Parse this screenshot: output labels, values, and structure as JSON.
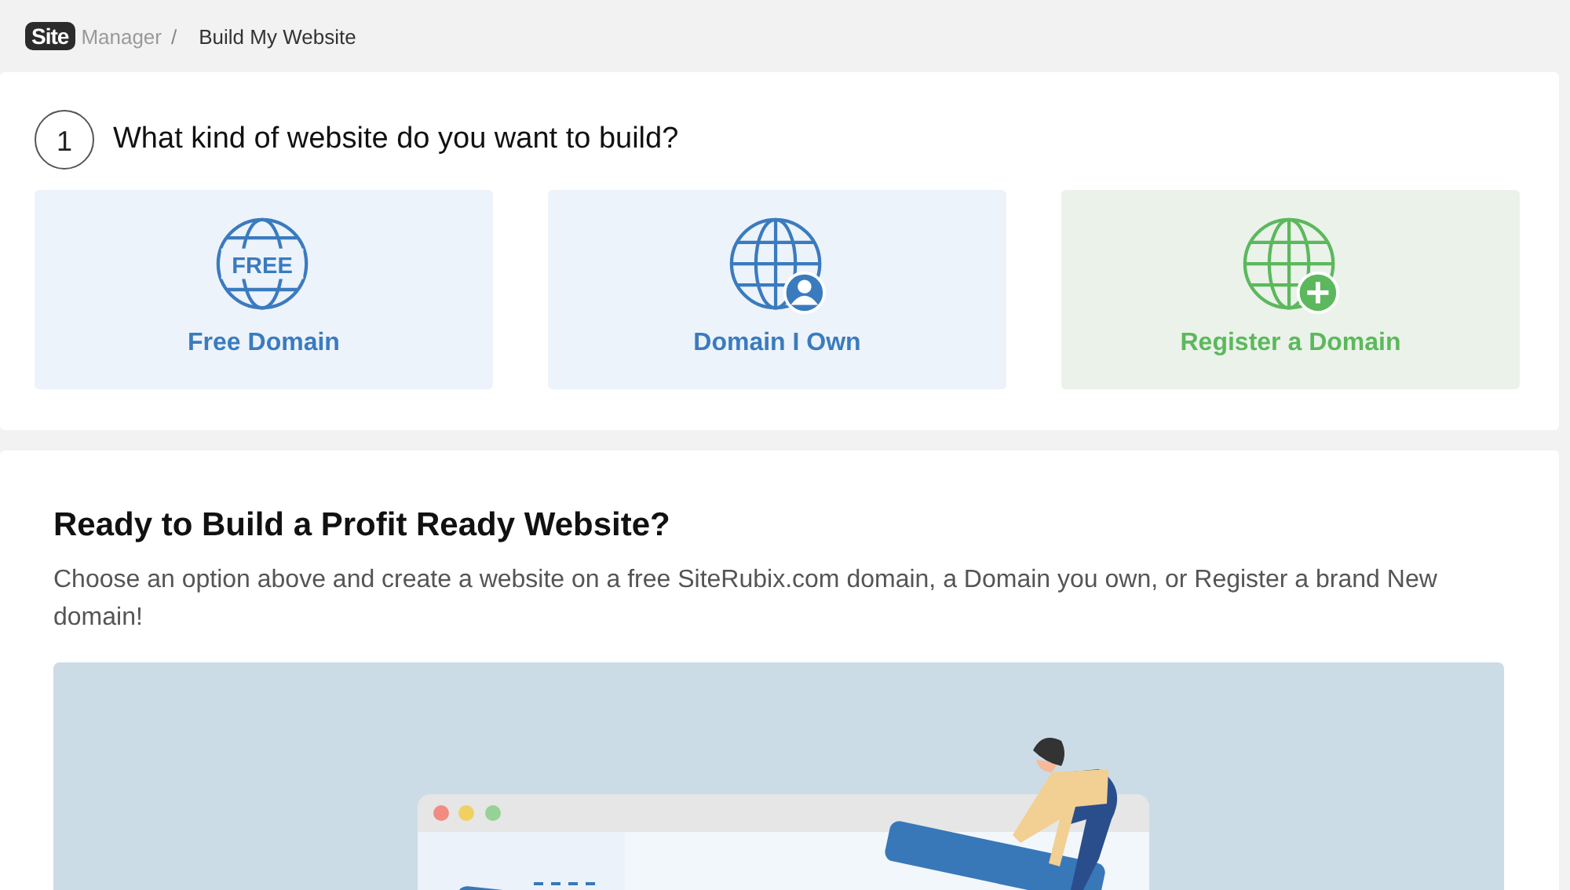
{
  "breadcrumb": {
    "logo": "Site",
    "section": "Manager",
    "separator": "/",
    "current": "Build My Website"
  },
  "step": {
    "number": "1",
    "question": "What kind of website do you want to build?"
  },
  "options": [
    {
      "kind": "free",
      "label": "Free Domain",
      "badge": "FREE",
      "color": "#3a7bbf"
    },
    {
      "kind": "own",
      "label": "Domain I Own",
      "color": "#3a7bbf"
    },
    {
      "kind": "register",
      "label": "Register a Domain",
      "color": "#5cb85c"
    }
  ],
  "intro": {
    "title": "Ready to Build a Profit Ready Website?",
    "text": "Choose an option above and create a website on a free SiteRubix.com domain, a Domain you own, or Register a brand New domain!"
  }
}
